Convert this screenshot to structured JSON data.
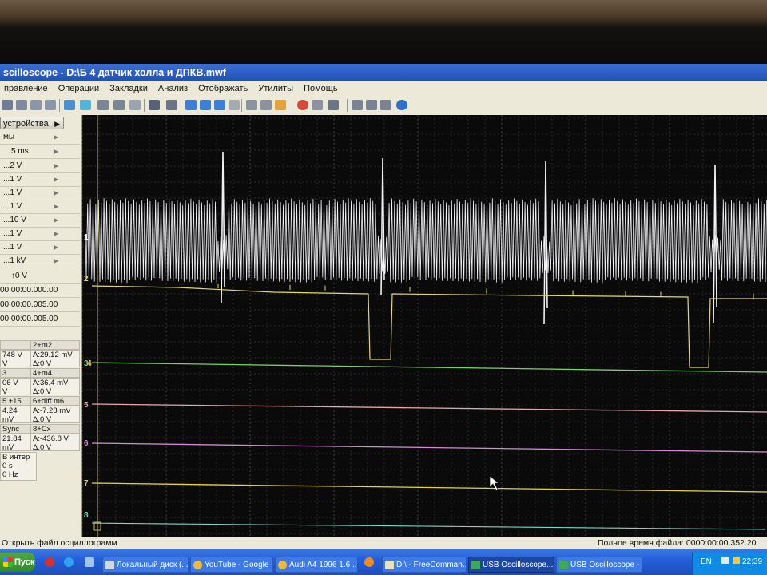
{
  "window": {
    "title": "scilloscope - D:\\Б 4 датчик холла и ДПКВ.mwf"
  },
  "menu": [
    "правление",
    "Операции",
    "Закладки",
    "Анализ",
    "Отображать",
    "Утилиты",
    "Помощь"
  ],
  "panel": {
    "device_button": "устройства",
    "section": "мы",
    "timebase": "5 ms",
    "channel_ranges": [
      "...2 V",
      "...1 V",
      "...1 V",
      "...1 V",
      "...10 V",
      "...1 V",
      "...1 V",
      "...1 kV"
    ],
    "trigger_level": "↑0 V",
    "times": [
      "00:00:00.000.00",
      "00:00:00.005.00",
      "00:00:00.005.00"
    ],
    "measurements": [
      {
        "header_left": "",
        "header_right": "2+m2",
        "left_a": "748 V",
        "left_d": "V",
        "right_a": "A:29.12 mV",
        "right_d": "Δ:0 V"
      },
      {
        "header_left": "3",
        "header_right": "4+m4",
        "left_a": "06 V",
        "left_d": "V",
        "right_a": "A:36.4 mV",
        "right_d": "Δ:0 V"
      },
      {
        "header_left": "5 ±15",
        "header_right": "6+diff m6",
        "left_a": "4.24 mV",
        "left_d": "V",
        "right_a": "A:-7.28 mV",
        "right_d": "Δ:0 V"
      },
      {
        "header_left": "Sync",
        "header_right": "8+Cx",
        "left_a": "21.84 mV",
        "left_d": "V",
        "right_a": "A:-436.8 V",
        "right_d": "Δ:0 V"
      }
    ],
    "extra": [
      "B интер",
      "0 s",
      "0 Hz"
    ]
  },
  "scope": {
    "channel_markers": [
      "1",
      "2",
      "3",
      "4",
      "5",
      "6",
      "7",
      "8"
    ],
    "colors": {
      "background": "#0a0a0a",
      "grid": "#4b4b4b",
      "ch1": "#f2f0f6",
      "ch2": "#e6d86a",
      "ch3": "#7ad06c",
      "ch5": "#e7a6ae",
      "ch6": "#d68ad6",
      "ch7": "#e4d24a",
      "ch8": "#7ed8cc",
      "cursor": "#c8b85a"
    }
  },
  "status": {
    "left": "Открыть файл осциллограмм",
    "right": "Полное время файла: 0000:00:00.352.20"
  },
  "taskbar": {
    "start": "Пуск",
    "buttons": [
      "Локальный диск (...",
      "YouTube - Google ...",
      "Audi A4 1996 1.6 ...",
      "D:\\ - FreeComman...",
      "USB Oscilloscope...",
      "USB Oscilloscope - ..."
    ],
    "lang": "EN",
    "clock": "22:39"
  }
}
